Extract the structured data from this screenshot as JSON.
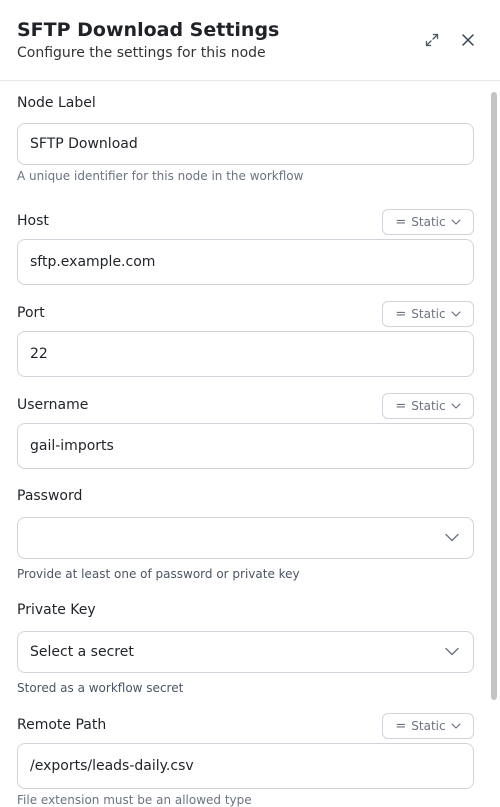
{
  "header": {
    "title": "SFTP Download Settings",
    "subtitle": "Configure the settings for this node"
  },
  "node_label": {
    "label": "Node Label",
    "value": "SFTP Download",
    "help": "A unique identifier for this node in the workflow"
  },
  "host": {
    "label": "Host",
    "mode": "Static",
    "value": "sftp.example.com"
  },
  "port": {
    "label": "Port",
    "mode": "Static",
    "value": "22"
  },
  "username": {
    "label": "Username",
    "mode": "Static",
    "value": "gail-imports"
  },
  "password": {
    "label": "Password",
    "value": "",
    "help": "Provide at least one of password or private key"
  },
  "private_key": {
    "label": "Private Key",
    "placeholder": "Select a secret",
    "help": "Stored as a workflow secret"
  },
  "remote_path": {
    "label": "Remote Path",
    "mode": "Static",
    "value": "/exports/leads-daily.csv",
    "help": "File extension must be an allowed type"
  }
}
